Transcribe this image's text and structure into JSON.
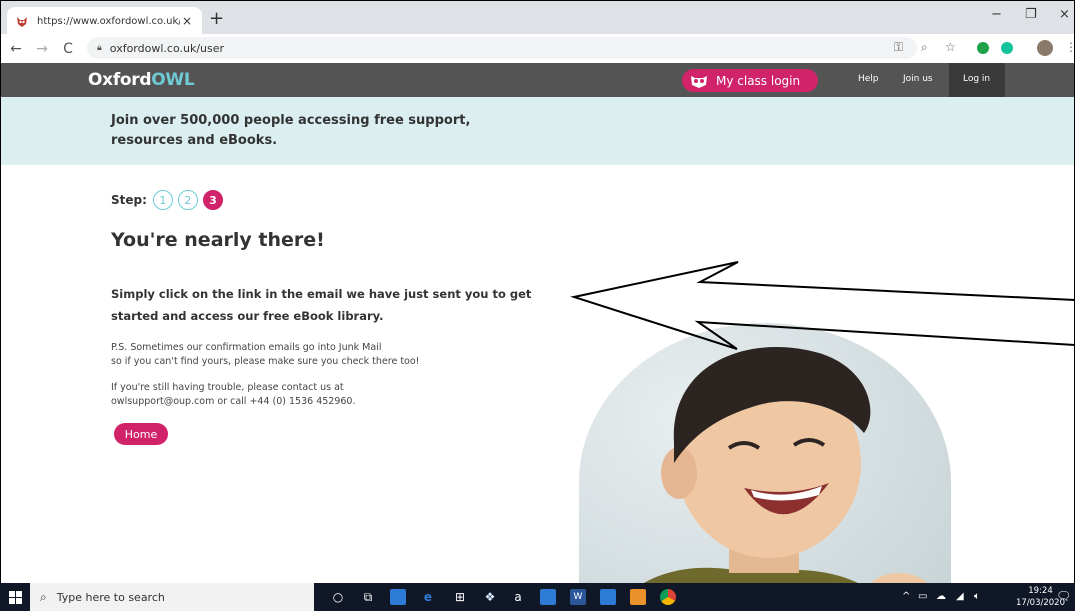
{
  "browser": {
    "tab_title": "https://www.oxfordowl.co.uk/use",
    "tab_close": "×",
    "new_tab": "+",
    "url": "oxfordowl.co.uk/user",
    "window_controls": {
      "minimize": "−",
      "restore": "❐",
      "close": "×"
    }
  },
  "site": {
    "logo_main": "Oxford",
    "logo_accent": "OWL",
    "my_class_login": "My class login",
    "nav": {
      "help": "Help",
      "join": "Join us",
      "login": "Log in"
    },
    "banner": "Join over 500,000 people accessing free support, resources and eBooks.",
    "step_label": "Step:",
    "steps": [
      "1",
      "2",
      "3"
    ],
    "heading": "You're nearly there!",
    "lead": "Simply click on the link in the email we have just sent you to get started and access our free eBook library.",
    "ps_line1": "P.S. Sometimes our confirmation emails go into Junk Mail",
    "ps_line2": "so if you can't find yours, please make sure you check there too!",
    "help_line1": "If you're still having trouble, please contact us at",
    "help_line2": "owlsupport@oup.com or call +44 (0) 1536 452960.",
    "home_button": "Home",
    "brand_color": "#d1236a",
    "accent_color": "#6fcad5"
  },
  "taskbar": {
    "search_placeholder": "Type here to search",
    "time": "19:24",
    "date": "17/03/2020"
  }
}
